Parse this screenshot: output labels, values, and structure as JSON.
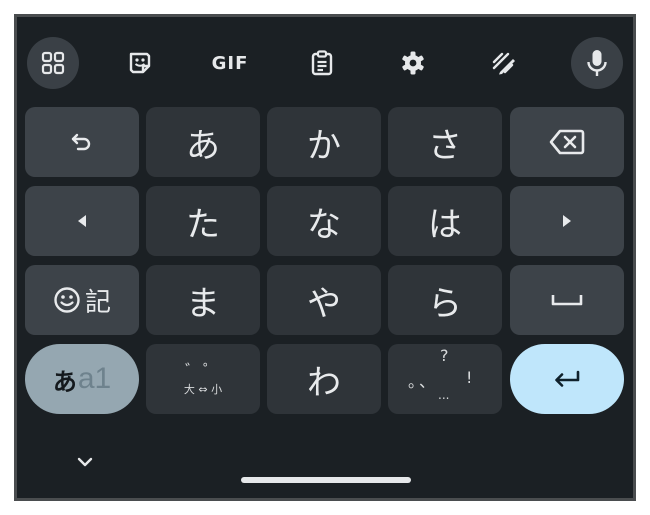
{
  "toolbar": {
    "gif_label": "GIF"
  },
  "keys": {
    "row1": {
      "k2": "あ",
      "k3": "か",
      "k4": "さ"
    },
    "row2": {
      "k2": "た",
      "k3": "な",
      "k4": "は"
    },
    "row3": {
      "emoji_label": "記",
      "k2": "ま",
      "k3": "や",
      "k4": "ら"
    },
    "row4": {
      "lang_kana": "あ",
      "lang_latin": "a1",
      "dakuten_top": "゛゜",
      "dakuten_bottom": "大 ⇔ 小",
      "k3": "わ",
      "punct_q": "?",
      "punct_mid": "。、",
      "punct_ex": "!",
      "punct_dots": "..."
    }
  },
  "colors": {
    "background": "#1b2024",
    "key": "#2f3439",
    "function_key": "#3d4349",
    "lang_key": "#95a7b1",
    "enter_key": "#bfe6fb"
  }
}
